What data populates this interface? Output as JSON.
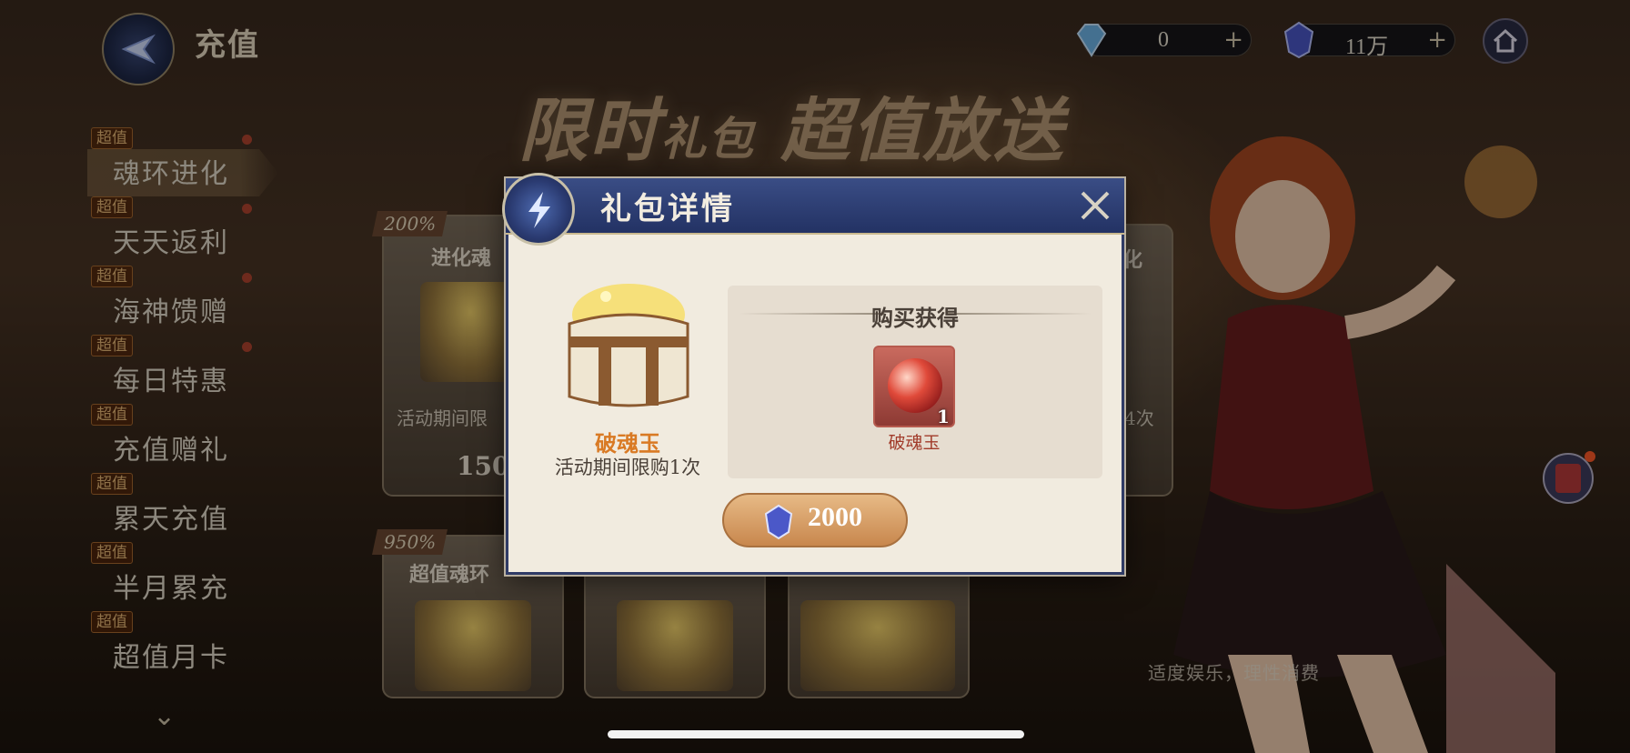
{
  "header": {
    "title": "充值",
    "currency_diamond": "0",
    "currency_crystal": "11万",
    "plus_symbol": "+"
  },
  "banner": {
    "part1": "限时",
    "part2": "礼包",
    "part3": "超值放送"
  },
  "sidebar": {
    "items": [
      {
        "tag": "超值",
        "label": "魂环进化"
      },
      {
        "tag": "超值",
        "label": "天天返利"
      },
      {
        "tag": "超值",
        "label": "海神馈赠"
      },
      {
        "tag": "超值",
        "label": "每日特惠"
      },
      {
        "tag": "超值",
        "label": "充值赠礼"
      },
      {
        "tag": "超值",
        "label": "累天充值"
      },
      {
        "tag": "超值",
        "label": "半月累充"
      },
      {
        "tag": "超值",
        "label": "超值月卡"
      }
    ],
    "more_arrow": "⌄"
  },
  "background_cards": {
    "card1": {
      "percent": "200%",
      "title": "进化魂",
      "note": "活动期间限",
      "price": "150"
    },
    "card2_note": "4次",
    "card2_title": "化",
    "card3": {
      "percent": "950%",
      "title": "超值魂环"
    }
  },
  "slogan": "适度娱乐，理性消费",
  "modal": {
    "title": "礼包详情",
    "item_name": "破魂玉",
    "item_limit": "活动期间限购1次",
    "reward_section_title": "购买获得",
    "reward": {
      "name": "破魂玉",
      "quantity": "1"
    },
    "price": "2000"
  },
  "colors": {
    "modal_header": "#2f3b66",
    "accent_orange": "#d97a24",
    "buy_button": "#c8874d"
  }
}
